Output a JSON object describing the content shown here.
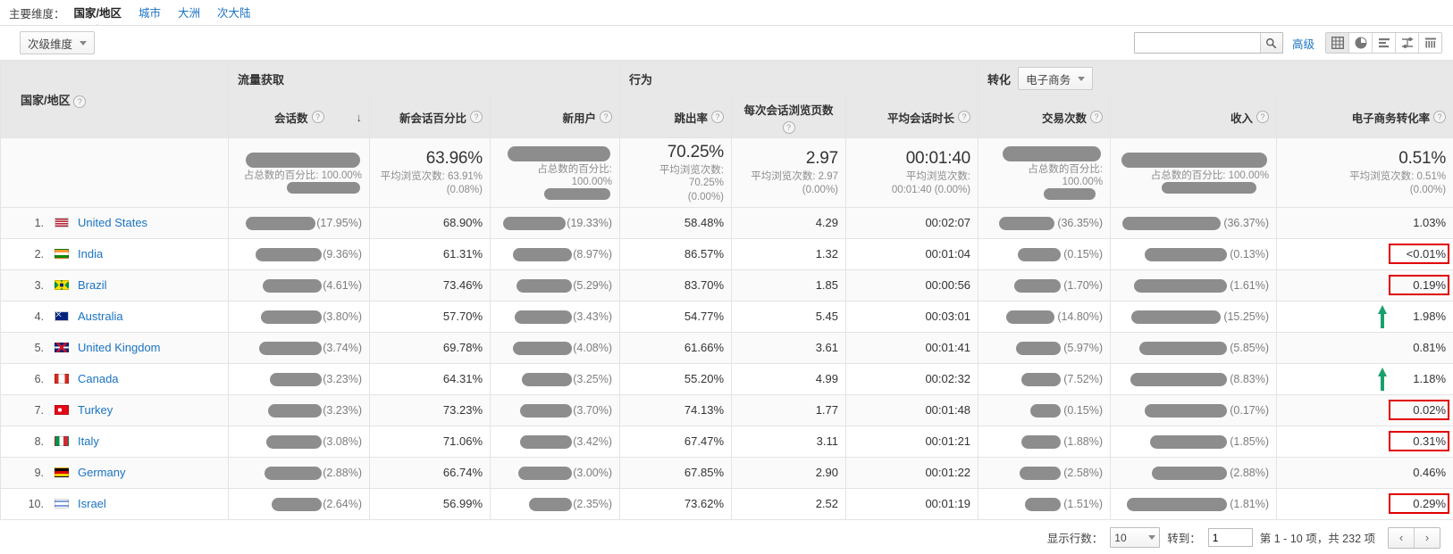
{
  "primary_dimension": {
    "label": "主要维度：",
    "tabs": [
      {
        "label": "国家/地区",
        "active": true
      },
      {
        "label": "城市",
        "active": false
      },
      {
        "label": "大洲",
        "active": false
      },
      {
        "label": "次大陆",
        "active": false
      }
    ]
  },
  "toolbar": {
    "secondary_dimension": "次级维度",
    "search_value": "",
    "search_placeholder": "",
    "advanced_label": "高级",
    "view_icons": [
      {
        "name": "table-view-icon",
        "selected": true
      },
      {
        "name": "pie-chart-view-icon",
        "selected": false
      },
      {
        "name": "performance-view-icon",
        "selected": false
      },
      {
        "name": "comparison-view-icon",
        "selected": false
      },
      {
        "name": "pivot-view-icon",
        "selected": false
      }
    ]
  },
  "table": {
    "dimension_header": "国家/地区",
    "groups": [
      {
        "label": "流量获取",
        "span": 3
      },
      {
        "label": "行为",
        "span": 4
      },
      {
        "label": "转化",
        "span": 3,
        "select": "电子商务"
      }
    ],
    "columns": [
      {
        "label": "会话数",
        "sorted": true,
        "sort_dir": "↓"
      },
      {
        "label": "新会话百分比"
      },
      {
        "label": "新用户"
      },
      {
        "label": "跳出率"
      },
      {
        "label": "每次会话浏览页数"
      },
      {
        "label": "平均会话时长"
      },
      {
        "label": "交易次数"
      },
      {
        "label": "收入"
      },
      {
        "label": "电子商务转化率"
      }
    ],
    "summary_row": [
      {
        "big": "",
        "redacted": true,
        "sub": "占总数的百分比: 100.00%",
        "sub2_redacted": true
      },
      {
        "big": "63.96%",
        "redacted": false,
        "sub": "平均浏览次数: 63.91%",
        "sub2": "(0.08%)"
      },
      {
        "big": "",
        "redacted": true,
        "sub": "占总数的百分比: 100.00%",
        "sub2_redacted": true
      },
      {
        "big": "70.25%",
        "redacted": false,
        "sub": "平均浏览次数: 70.25%",
        "sub2": "(0.00%)"
      },
      {
        "big": "2.97",
        "redacted": false,
        "sub": "平均浏览次数: 2.97",
        "sub2": "(0.00%)"
      },
      {
        "big": "00:01:40",
        "redacted": false,
        "sub": "平均浏览次数:",
        "sub2": "00:01:40 (0.00%)"
      },
      {
        "big": "",
        "redacted": true,
        "sub": "占总数的百分比: 100.00%",
        "sub2_redacted": true
      },
      {
        "big": "",
        "redacted": true,
        "sub": "占总数的百分比: 100.00%",
        "sub2_redacted": true
      },
      {
        "big": "0.51%",
        "redacted": false,
        "sub": "平均浏览次数: 0.51%",
        "sub2": "(0.00%)"
      }
    ],
    "rows": [
      {
        "index": "1.",
        "country": "United States",
        "flag": "us",
        "sessions_pct": "(17.95%)",
        "new_session_pct": "68.90%",
        "new_users_pct": "(19.33%)",
        "bounce_rate": "58.48%",
        "pages_per_session": "4.29",
        "avg_duration": "00:02:07",
        "transactions_pct": "(36.35%)",
        "revenue_pct": "(36.37%)",
        "conv_rate": "1.03%",
        "annotation": "none"
      },
      {
        "index": "2.",
        "country": "India",
        "flag": "in",
        "sessions_pct": "(9.36%)",
        "new_session_pct": "61.31%",
        "new_users_pct": "(8.97%)",
        "bounce_rate": "86.57%",
        "pages_per_session": "1.32",
        "avg_duration": "00:01:04",
        "transactions_pct": "(0.15%)",
        "revenue_pct": "(0.13%)",
        "conv_rate": "<0.01%",
        "annotation": "red-box"
      },
      {
        "index": "3.",
        "country": "Brazil",
        "flag": "br",
        "sessions_pct": "(4.61%)",
        "new_session_pct": "73.46%",
        "new_users_pct": "(5.29%)",
        "bounce_rate": "83.70%",
        "pages_per_session": "1.85",
        "avg_duration": "00:00:56",
        "transactions_pct": "(1.70%)",
        "revenue_pct": "(1.61%)",
        "conv_rate": "0.19%",
        "annotation": "red-box"
      },
      {
        "index": "4.",
        "country": "Australia",
        "flag": "au",
        "sessions_pct": "(3.80%)",
        "new_session_pct": "57.70%",
        "new_users_pct": "(3.43%)",
        "bounce_rate": "54.77%",
        "pages_per_session": "5.45",
        "avg_duration": "00:03:01",
        "transactions_pct": "(14.80%)",
        "revenue_pct": "(15.25%)",
        "conv_rate": "1.98%",
        "annotation": "green-arrow"
      },
      {
        "index": "5.",
        "country": "United Kingdom",
        "flag": "gb",
        "sessions_pct": "(3.74%)",
        "new_session_pct": "69.78%",
        "new_users_pct": "(4.08%)",
        "bounce_rate": "61.66%",
        "pages_per_session": "3.61",
        "avg_duration": "00:01:41",
        "transactions_pct": "(5.97%)",
        "revenue_pct": "(5.85%)",
        "conv_rate": "0.81%",
        "annotation": "none"
      },
      {
        "index": "6.",
        "country": "Canada",
        "flag": "ca",
        "sessions_pct": "(3.23%)",
        "new_session_pct": "64.31%",
        "new_users_pct": "(3.25%)",
        "bounce_rate": "55.20%",
        "pages_per_session": "4.99",
        "avg_duration": "00:02:32",
        "transactions_pct": "(7.52%)",
        "revenue_pct": "(8.83%)",
        "conv_rate": "1.18%",
        "annotation": "green-arrow"
      },
      {
        "index": "7.",
        "country": "Turkey",
        "flag": "tr",
        "sessions_pct": "(3.23%)",
        "new_session_pct": "73.23%",
        "new_users_pct": "(3.70%)",
        "bounce_rate": "74.13%",
        "pages_per_session": "1.77",
        "avg_duration": "00:01:48",
        "transactions_pct": "(0.15%)",
        "revenue_pct": "(0.17%)",
        "conv_rate": "0.02%",
        "annotation": "red-box"
      },
      {
        "index": "8.",
        "country": "Italy",
        "flag": "it",
        "sessions_pct": "(3.08%)",
        "new_session_pct": "71.06%",
        "new_users_pct": "(3.42%)",
        "bounce_rate": "67.47%",
        "pages_per_session": "3.11",
        "avg_duration": "00:01:21",
        "transactions_pct": "(1.88%)",
        "revenue_pct": "(1.85%)",
        "conv_rate": "0.31%",
        "annotation": "red-box"
      },
      {
        "index": "9.",
        "country": "Germany",
        "flag": "de",
        "sessions_pct": "(2.88%)",
        "new_session_pct": "66.74%",
        "new_users_pct": "(3.00%)",
        "bounce_rate": "67.85%",
        "pages_per_session": "2.90",
        "avg_duration": "00:01:22",
        "transactions_pct": "(2.58%)",
        "revenue_pct": "(2.88%)",
        "conv_rate": "0.46%",
        "annotation": "none"
      },
      {
        "index": "10.",
        "country": "Israel",
        "flag": "il",
        "sessions_pct": "(2.64%)",
        "new_session_pct": "56.99%",
        "new_users_pct": "(2.35%)",
        "bounce_rate": "73.62%",
        "pages_per_session": "2.52",
        "avg_duration": "00:01:19",
        "transactions_pct": "(1.51%)",
        "revenue_pct": "(1.81%)",
        "conv_rate": "0.29%",
        "annotation": "red-box"
      }
    ]
  },
  "footer": {
    "rows_label": "显示行数：",
    "rows_value": "10",
    "goto_label": "转到：",
    "goto_value": "1",
    "range_text": "第 1 - 10 项，共 232 项",
    "prev_icon": "‹",
    "next_icon": "›"
  },
  "colors": {
    "link": "#1a73c2",
    "annotation_red": "#e00000",
    "annotation_green": "#1aa06d",
    "redaction_gray": "#8d8d8d",
    "header_gray": "#e8e8e8"
  }
}
